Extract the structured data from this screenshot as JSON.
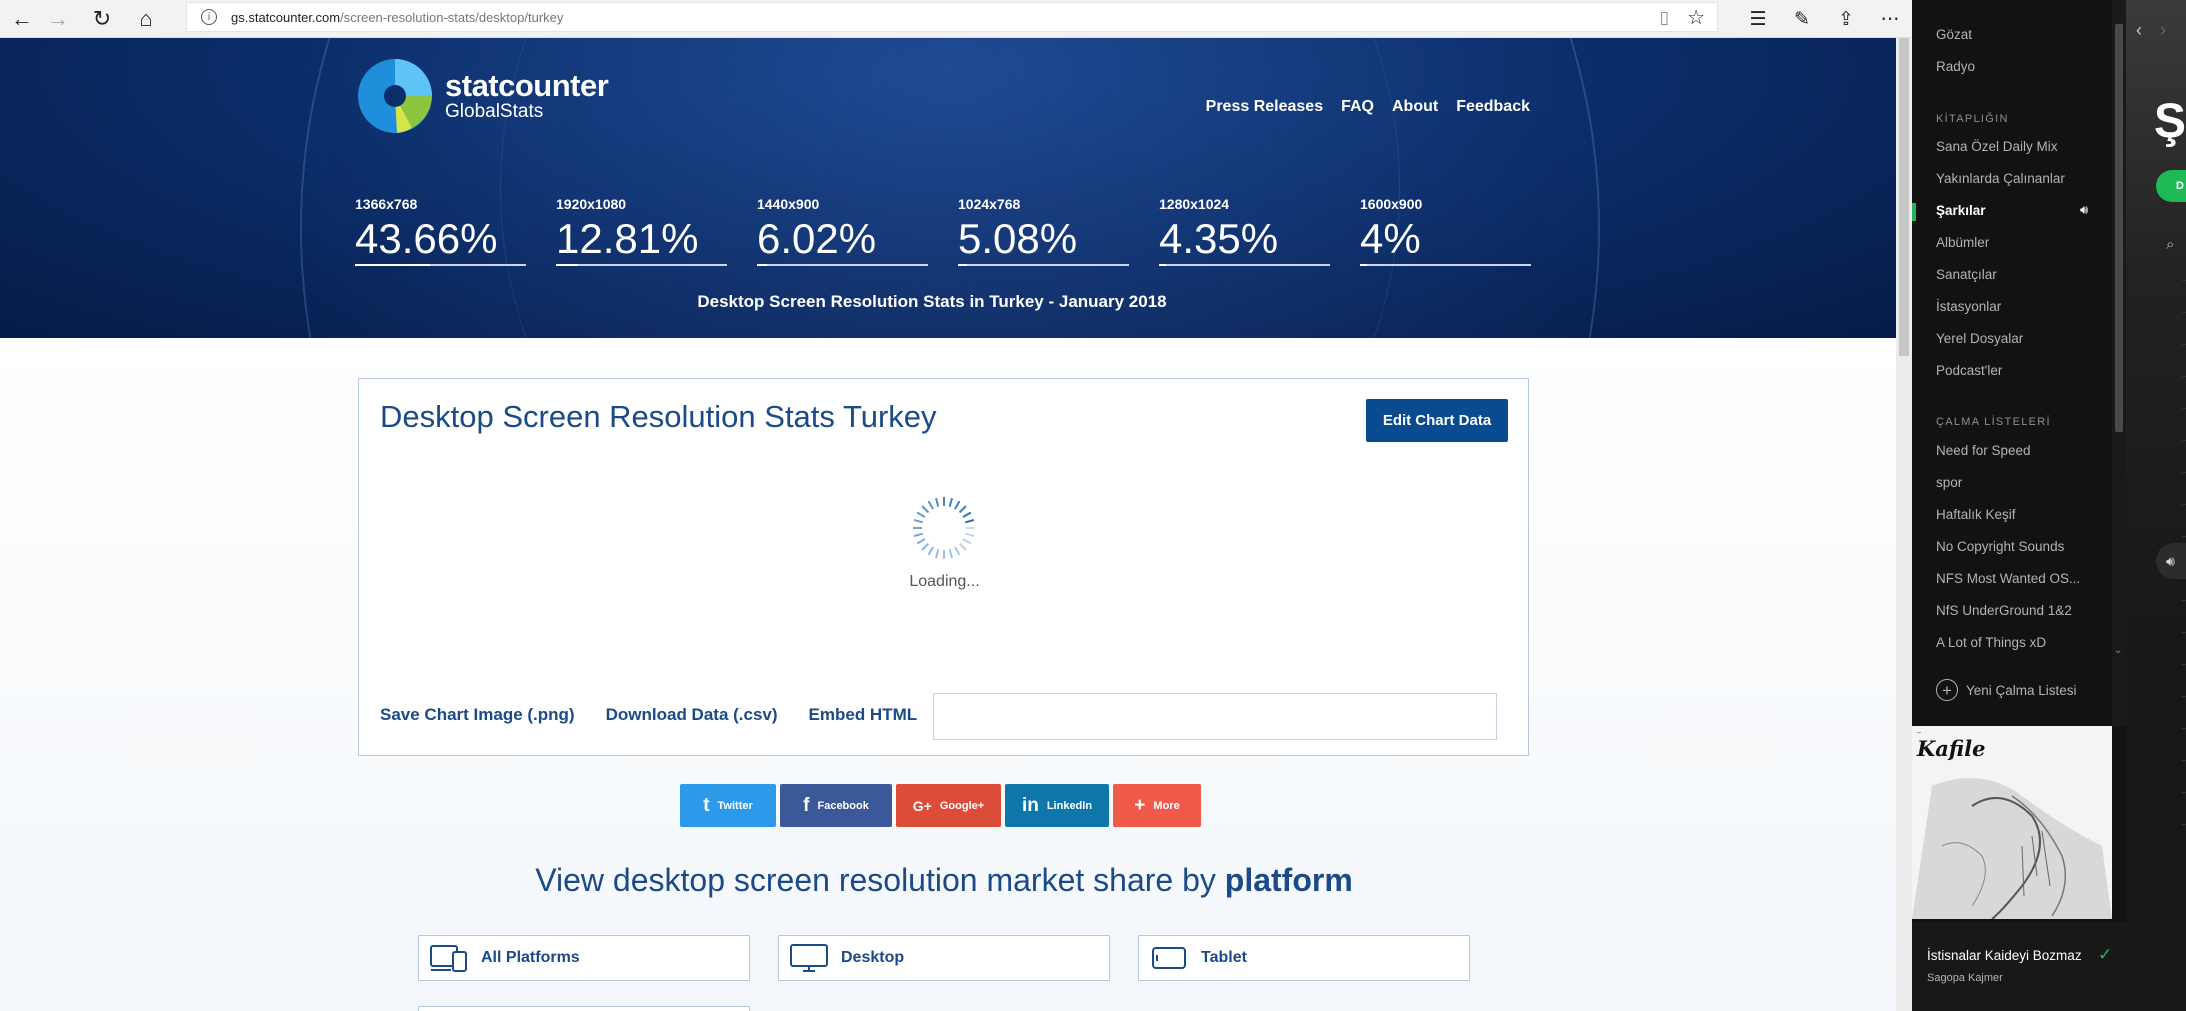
{
  "browser": {
    "url_host": "gs.statcounter.com",
    "url_path": "/screen-resolution-stats/desktop/turkey"
  },
  "header": {
    "logo_line1": "statcounter",
    "logo_line2": "GlobalStats",
    "nav": [
      "Press Releases",
      "FAQ",
      "About",
      "Feedback"
    ],
    "stats": [
      {
        "res": "1366x768",
        "pct": "43.66%",
        "share": 43.66
      },
      {
        "res": "1920x1080",
        "pct": "12.81%",
        "share": 12.81
      },
      {
        "res": "1440x900",
        "pct": "6.02%",
        "share": 6.02
      },
      {
        "res": "1024x768",
        "pct": "5.08%",
        "share": 5.08
      },
      {
        "res": "1280x1024",
        "pct": "4.35%",
        "share": 4.35
      },
      {
        "res": "1600x900",
        "pct": "4%",
        "share": 4
      }
    ],
    "caption": "Desktop Screen Resolution Stats in Turkey - January 2018"
  },
  "chart": {
    "title": "Desktop Screen Resolution Stats Turkey",
    "edit_label": "Edit Chart Data",
    "loading_text": "Loading...",
    "save_label": "Save Chart Image (.png)",
    "download_label": "Download Data (.csv)",
    "embed_label": "Embed HTML",
    "embed_value": ""
  },
  "share": [
    {
      "label": "Twitter",
      "glyph": "t",
      "color": "#2c9ae8",
      "icon": "twitter-icon"
    },
    {
      "label": "Facebook",
      "glyph": "f",
      "color": "#3b5998",
      "icon": "facebook-icon"
    },
    {
      "label": "Google+",
      "glyph": "G+",
      "color": "#dd4b39",
      "icon": "google-plus-icon"
    },
    {
      "label": "LinkedIn",
      "glyph": "in",
      "color": "#0e76a8",
      "icon": "linkedin-icon"
    },
    {
      "label": "More",
      "glyph": "+",
      "color": "#f15a4a",
      "icon": "plus-icon"
    }
  ],
  "platform_section": {
    "title_prefix": "View desktop screen resolution market share by ",
    "title_bold": "platform",
    "items": [
      "All Platforms",
      "Desktop",
      "Tablet"
    ]
  },
  "spotify": {
    "top_items": [
      "Gözat",
      "Radyo"
    ],
    "library_heading": "KİTAPLIĞIN",
    "library_items": [
      "Sana Özel Daily Mix",
      "Yakınlarda Çalınanlar",
      "Şarkılar",
      "Albümler",
      "Sanatçılar",
      "İstasyonlar",
      "Yerel Dosyalar",
      "Podcast'ler"
    ],
    "active_item": "Şarkılar",
    "playlists_heading": "ÇALMA LİSTELERİ",
    "playlists": [
      "Need for Speed",
      "spor",
      "Haftalık Keşif",
      "No Copyright Sounds",
      "NFS Most Wanted OS...",
      "NfS UnderGround 1&2",
      "A Lot of Things xD"
    ],
    "new_playlist": "Yeni Çalma Listesi",
    "cover_title": "Kafile",
    "now_playing_title": "İstisnalar Kaideyi Bozmaz",
    "now_playing_artist": "Sagopa Kajmer",
    "main_big_text": "Şa",
    "main_button": "D"
  }
}
